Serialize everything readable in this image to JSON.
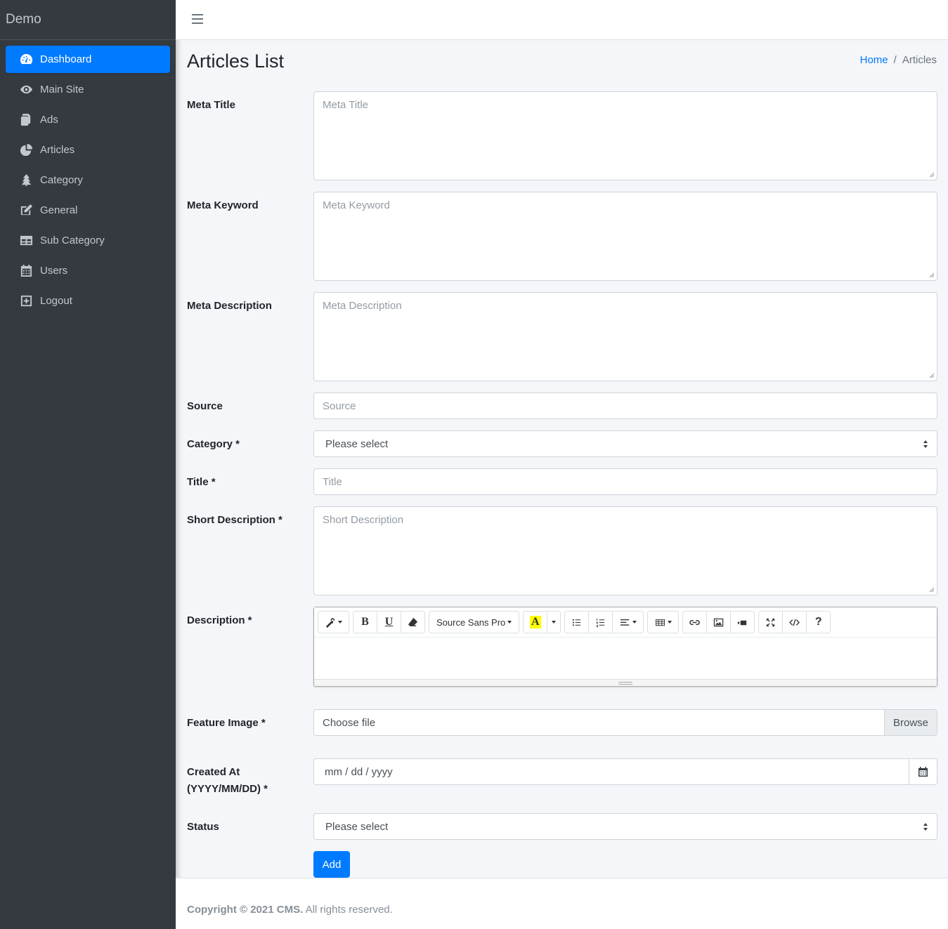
{
  "brand": "Demo",
  "sidebar": {
    "items": [
      {
        "label": "Dashboard",
        "icon": "tachometer-icon"
      },
      {
        "label": "Main Site",
        "icon": "eye-icon"
      },
      {
        "label": "Ads",
        "icon": "copy-icon"
      },
      {
        "label": "Articles",
        "icon": "chart-pie-icon"
      },
      {
        "label": "Category",
        "icon": "tree-icon"
      },
      {
        "label": "General",
        "icon": "edit-icon"
      },
      {
        "label": "Sub Category",
        "icon": "table-icon"
      },
      {
        "label": "Users",
        "icon": "calendar-icon"
      },
      {
        "label": "Logout",
        "icon": "plus-square-icon"
      }
    ],
    "active": "Dashboard"
  },
  "header": {
    "title": "Articles List",
    "breadcrumb": {
      "home": "Home",
      "separator": "/",
      "current": "Articles"
    }
  },
  "form": {
    "meta_title": {
      "label": "Meta Title",
      "placeholder": "Meta Title"
    },
    "meta_keyword": {
      "label": "Meta Keyword",
      "placeholder": "Meta Keyword"
    },
    "meta_description": {
      "label": "Meta Description",
      "placeholder": "Meta Description"
    },
    "source": {
      "label": "Source",
      "placeholder": "Source"
    },
    "category": {
      "label": "Category *",
      "value": "Please select"
    },
    "title": {
      "label": "Title *",
      "placeholder": "Title"
    },
    "short_description": {
      "label": "Short Description *",
      "placeholder": "Short Description"
    },
    "description": {
      "label": "Description *",
      "font_name": "Source Sans Pro"
    },
    "feature_image": {
      "label": "Feature Image *",
      "file_text": "Choose file",
      "browse": "Browse"
    },
    "created_at": {
      "label_line1": "Created At",
      "label_line2": "(YYYY/MM/DD) *",
      "value": "mm / dd / yyyy"
    },
    "status": {
      "label": "Status",
      "value": "Please select"
    },
    "submit": "Add"
  },
  "footer": {
    "bold": "Copyright © 2021 CMS.",
    "rest": " All rights reserved."
  },
  "colors": {
    "sidebar": "#343a40",
    "accent": "#007bff",
    "page_bg": "#f4f6f9"
  }
}
